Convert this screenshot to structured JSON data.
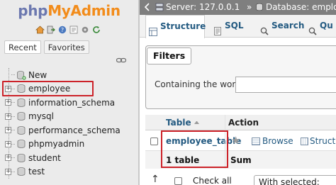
{
  "sidebar": {
    "logo": {
      "php": "php",
      "rest": "MyAdmin"
    },
    "toolbar_icons": [
      "home-icon",
      "logout-icon",
      "docs-icon",
      "sql-docs-icon",
      "settings-icon",
      "reload-icon"
    ],
    "tabs": [
      {
        "label": "Recent"
      },
      {
        "label": "Favorites"
      }
    ],
    "tree": [
      {
        "label": "New",
        "icon": "new-database-icon",
        "selected": false
      },
      {
        "label": "employee",
        "icon": "database-icon",
        "selected": true
      },
      {
        "label": "information_schema",
        "icon": "database-icon",
        "selected": false
      },
      {
        "label": "mysql",
        "icon": "database-icon",
        "selected": false
      },
      {
        "label": "performance_schema",
        "icon": "database-icon",
        "selected": false
      },
      {
        "label": "phpmyadmin",
        "icon": "database-icon",
        "selected": false
      },
      {
        "label": "student",
        "icon": "database-icon",
        "selected": false
      },
      {
        "label": "test",
        "icon": "database-icon",
        "selected": false
      }
    ],
    "expander_symbol": "+"
  },
  "breadcrumb": {
    "server": "Server: 127.0.0.1",
    "separator": "»",
    "database": "Database: employee"
  },
  "tabs": [
    {
      "label": "Structure",
      "icon": "structure-icon",
      "active": true
    },
    {
      "label": "SQL",
      "icon": "sql-icon",
      "active": false
    },
    {
      "label": "Search",
      "icon": "search-icon",
      "active": false
    },
    {
      "label": "Qu",
      "icon": "query-icon",
      "active": false
    }
  ],
  "filters": {
    "legend": "Filters",
    "label": "Containing the word:",
    "value": ""
  },
  "table": {
    "headers": {
      "table": "Table",
      "action": "Action"
    },
    "rows": [
      {
        "name": "employee_table",
        "browse": "Browse",
        "structure": "Structure"
      }
    ],
    "summary": {
      "count": "1 table",
      "action": "Sum"
    }
  },
  "bottom": {
    "arrow": "↑",
    "check_all": "Check all",
    "with_selected": "With selected:"
  },
  "colors": {
    "highlight": "#cc2229",
    "link": "#235a81",
    "logo_php": "#6c78af",
    "logo_rest": "#f28c1b",
    "topbar": "#7f7f7f"
  }
}
